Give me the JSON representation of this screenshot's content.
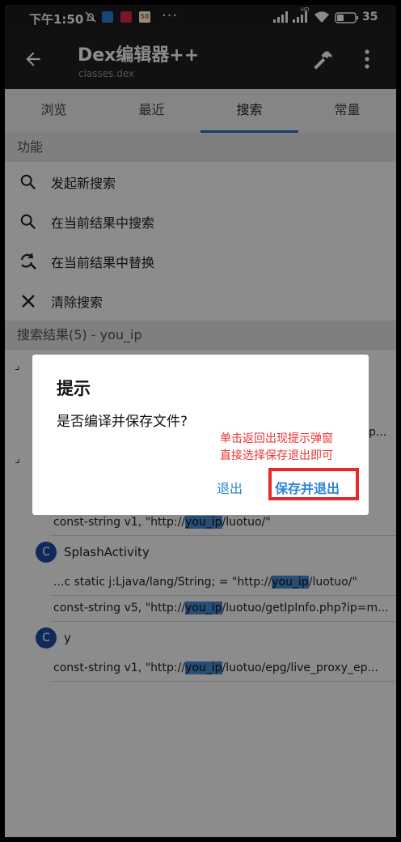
{
  "status_bar": {
    "time": "下午1:50",
    "app_badge_58": "58",
    "overflow_dots": "···",
    "network_label": "HD",
    "battery": "35"
  },
  "app_bar": {
    "title": "Dex编辑器++",
    "subtitle": "classes.dex"
  },
  "tabs": [
    {
      "label": "浏览"
    },
    {
      "label": "最近"
    },
    {
      "label": "搜索"
    },
    {
      "label": "常量"
    }
  ],
  "functions": {
    "header": "功能",
    "items": [
      {
        "label": "发起新搜索",
        "icon": "search-icon"
      },
      {
        "label": "在当前结果中搜索",
        "icon": "search-icon"
      },
      {
        "label": "在当前结果中替换",
        "icon": "replace-icon"
      },
      {
        "label": "清除搜索",
        "icon": "close-icon"
      }
    ]
  },
  "results": {
    "header": "搜索结果(5) - you_ip",
    "hidden_snippet": "p...",
    "rows": [
      {
        "kind": "code",
        "prefix": "const-string v1, \"http://",
        "match": "you_ip",
        "suffix": "/luotuo/\""
      },
      {
        "kind": "class",
        "badge": "C",
        "name": "SplashActivity"
      },
      {
        "kind": "code",
        "prefix": "...c static j:Ljava/lang/String; = \"http://",
        "match": "you_ip",
        "suffix": "/luotuo/\""
      },
      {
        "kind": "code",
        "prefix": "const-string v5, \"http://",
        "match": "you_ip",
        "suffix": "/luotuo/getIpInfo.php?ip=m..."
      },
      {
        "kind": "class",
        "badge": "C",
        "name": "y"
      },
      {
        "kind": "code",
        "prefix": "const-string v1, \"http://",
        "match": "you_ip",
        "suffix": "/luotuo/epg/live_proxy_ep..."
      }
    ]
  },
  "dialog": {
    "title": "提示",
    "message": "是否编译并保存文件?",
    "note_line1": "单击返回出现提示弹窗",
    "note_line2": "直接选择保存退出即可",
    "exit_label": "退出",
    "save_exit_label": "保存并退出"
  },
  "colors": {
    "accent": "#1e6fc6",
    "dialog_button": "#2a86d8",
    "annotation_red": "#e42a2a",
    "class_badge": "#1f4ea8",
    "match_highlight": "#4a8fd6"
  }
}
